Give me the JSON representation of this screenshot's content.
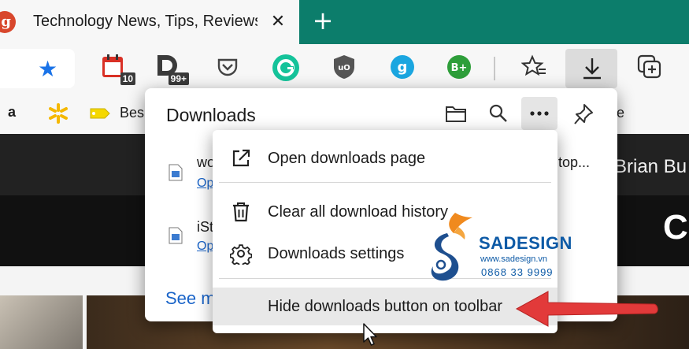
{
  "tab": {
    "favicon_letter": "g",
    "title": "Technology News, Tips, Reviews,",
    "close_glyph": "✕",
    "new_tab_glyph": "+"
  },
  "toolbar": {
    "favorite_icon": "star-icon",
    "extensions": [
      {
        "name": "calendar-extension-icon",
        "badge": "10"
      },
      {
        "name": "d-extension-icon",
        "badge": "99+"
      },
      {
        "name": "pocket-icon",
        "badge": ""
      },
      {
        "name": "grammarly-icon",
        "badge": ""
      },
      {
        "name": "ublock-icon",
        "badge": ""
      },
      {
        "name": "g-extension-icon",
        "badge": ""
      },
      {
        "name": "b-plus-icon",
        "badge": ""
      }
    ],
    "collections_icon": "star-list-icon",
    "downloads_icon": "download-arrow-icon",
    "extra_icon": "add-collection-icon"
  },
  "favorites_bar": {
    "items": [
      "a",
      "Bes",
      "e"
    ]
  },
  "page": {
    "author_text": "Brian Bu",
    "big_letter": "C"
  },
  "downloads": {
    "title": "Downloads",
    "items": [
      {
        "name": "wo",
        "name_tail": "top...",
        "action": "Op"
      },
      {
        "name": "iSt",
        "action": "Op"
      }
    ],
    "see_more": "See m"
  },
  "menu": {
    "open_page": "Open downloads page",
    "clear_history": "Clear all download history",
    "settings": "Downloads settings",
    "hide_button": "Hide downloads button on toolbar"
  },
  "watermark": {
    "brand": "SADESIGN",
    "site": "www.sadesign.vn",
    "phone": "0868 33 9999"
  },
  "colors": {
    "tabstrip": "#0c7d6b",
    "link": "#1a64c8",
    "arrow": "#e23a3a",
    "brand": "#0d5aa6"
  }
}
